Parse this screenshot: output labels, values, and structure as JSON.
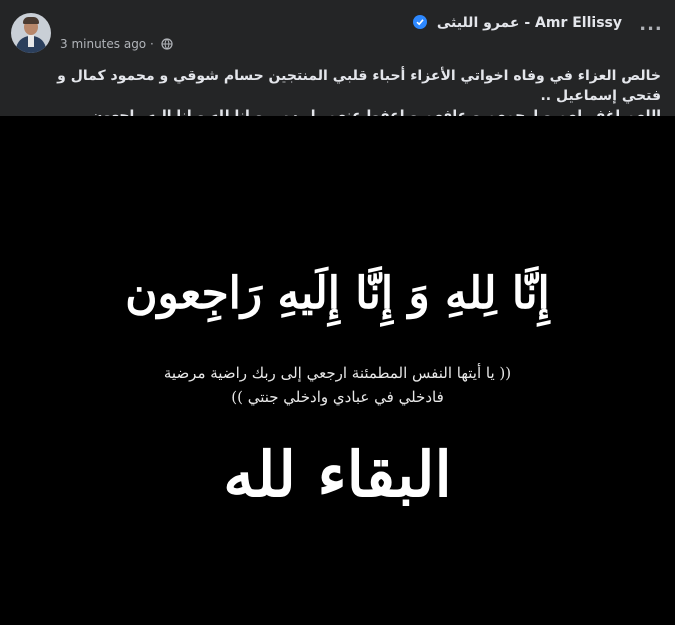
{
  "post": {
    "author_name": "Amr Ellissy - عمرو الليثى",
    "timestamp": "3 minutes ago",
    "separator": "·",
    "more_label": "...",
    "caption_line1": "خالص العزاء في وفاه اخواتي الأعزاء أحباء قلبي المنتجين حسام شوقي و محمود كمال و فتحي إسماعيل ..",
    "caption_line2": "اللهم اغفر لهم و ارحمهم و عافهم و اعفوا عنهم يا رب .. و إنا لله و إنا اليه راجعون",
    "icons": {
      "verified": "verified-badge-icon",
      "audience": "globe-icon",
      "menu": "more-options-icon"
    }
  },
  "image": {
    "line1": "إِنَّا لِلهِ وَ إِنَّا إِلَيهِ رَاجِعون",
    "line2": "(( يا أيتها النفس المطمئنة ارجعي إلى ربك راضية مرضية",
    "line3": "فادخلي في عبادي وادخلي جنتي ))",
    "line4": "البقاء لله"
  },
  "colors": {
    "background": "#242526",
    "text": "#e4e6eb",
    "secondary": "#b0b3b8",
    "verified": "#2d88ff",
    "image_bg": "#000000"
  }
}
